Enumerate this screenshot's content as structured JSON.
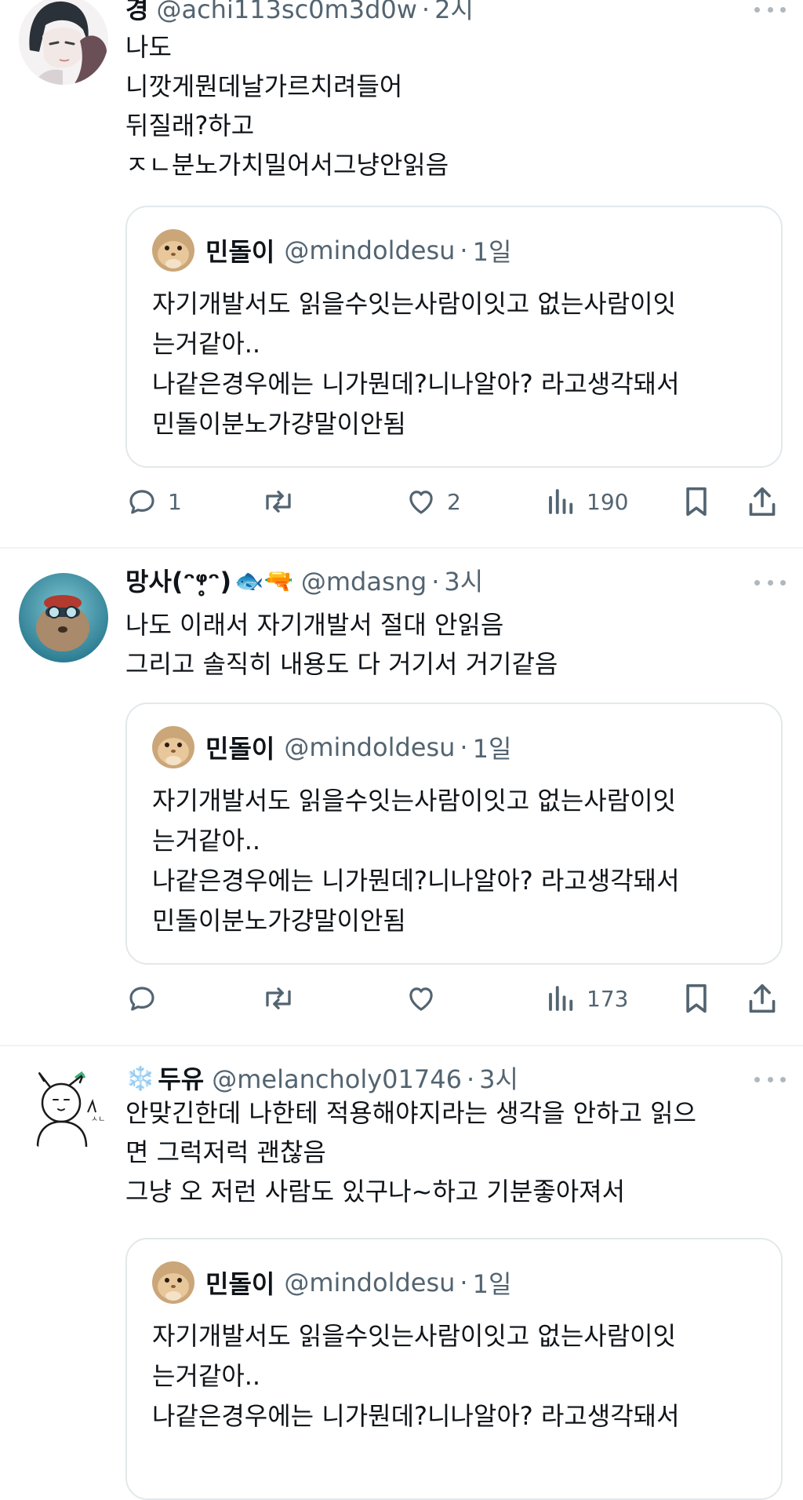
{
  "posts": [
    {
      "author_name": "경",
      "author_handle": "@achi113sc0m3d0w",
      "time": "2시",
      "body": [
        "나도",
        "니깟게뭔데날가르치려들어",
        "뒤질래?하고",
        "ㅈㄴ분노가치밀어서그냥안읽음"
      ],
      "actions": {
        "replies": "1",
        "reposts": "",
        "likes": "2",
        "views": "190"
      }
    },
    {
      "author_name": "망사(ᵔᵠ̥ᵔ)",
      "author_name_emoji": "🐟🔫",
      "author_handle": "@mdasng",
      "time": "3시",
      "body": [
        "나도 이래서 자기개발서 절대 안읽음",
        "그리고 솔직히 내용도 다 거기서 거기같음"
      ],
      "actions": {
        "replies": "",
        "reposts": "",
        "likes": "",
        "views": "173"
      }
    },
    {
      "author_name_emoji": "❄️",
      "author_name": "두유",
      "author_handle": "@melancholy01746",
      "time": "3시",
      "body": [
        "안맞긴한데 나한테 적용해야지라는 생각을 안하고 읽으",
        "면 그럭저럭 괜찮음",
        "그냥 오 저런 사람도 있구나~하고 기분좋아져서"
      ]
    }
  ],
  "quoted": {
    "name": "민돌이",
    "handle": "@mindoldesu",
    "time": "1일",
    "text": [
      "자기개발서도 읽을수잇는사람이잇고 없는사람이잇",
      "는거같아..",
      "나같은경우에는 니가뭔데?니나알아? 라고생각돼서",
      "민돌이분노가걍말이안됨"
    ]
  },
  "separator": "·",
  "icons": [
    "reply-icon",
    "repost-icon",
    "like-icon",
    "views-icon",
    "bookmark-icon",
    "share-icon",
    "more-icon"
  ],
  "colors": {
    "text": "#0f1419",
    "secondary": "#536471",
    "border": "#e3e8eb",
    "divider": "#eff3f4"
  }
}
